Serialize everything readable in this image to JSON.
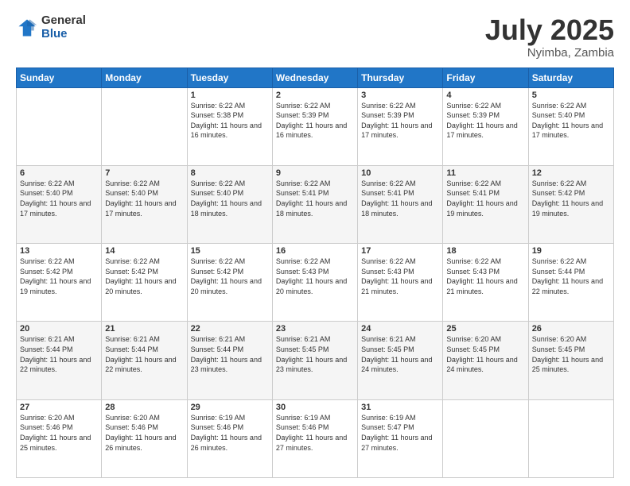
{
  "logo": {
    "general": "General",
    "blue": "Blue"
  },
  "title": {
    "month": "July 2025",
    "location": "Nyimba, Zambia"
  },
  "days_of_week": [
    "Sunday",
    "Monday",
    "Tuesday",
    "Wednesday",
    "Thursday",
    "Friday",
    "Saturday"
  ],
  "weeks": [
    [
      null,
      null,
      {
        "day": 1,
        "sunrise": "6:22 AM",
        "sunset": "5:38 PM",
        "daylight": "11 hours and 16 minutes."
      },
      {
        "day": 2,
        "sunrise": "6:22 AM",
        "sunset": "5:39 PM",
        "daylight": "11 hours and 16 minutes."
      },
      {
        "day": 3,
        "sunrise": "6:22 AM",
        "sunset": "5:39 PM",
        "daylight": "11 hours and 17 minutes."
      },
      {
        "day": 4,
        "sunrise": "6:22 AM",
        "sunset": "5:39 PM",
        "daylight": "11 hours and 17 minutes."
      },
      {
        "day": 5,
        "sunrise": "6:22 AM",
        "sunset": "5:40 PM",
        "daylight": "11 hours and 17 minutes."
      }
    ],
    [
      {
        "day": 6,
        "sunrise": "6:22 AM",
        "sunset": "5:40 PM",
        "daylight": "11 hours and 17 minutes."
      },
      {
        "day": 7,
        "sunrise": "6:22 AM",
        "sunset": "5:40 PM",
        "daylight": "11 hours and 17 minutes."
      },
      {
        "day": 8,
        "sunrise": "6:22 AM",
        "sunset": "5:40 PM",
        "daylight": "11 hours and 18 minutes."
      },
      {
        "day": 9,
        "sunrise": "6:22 AM",
        "sunset": "5:41 PM",
        "daylight": "11 hours and 18 minutes."
      },
      {
        "day": 10,
        "sunrise": "6:22 AM",
        "sunset": "5:41 PM",
        "daylight": "11 hours and 18 minutes."
      },
      {
        "day": 11,
        "sunrise": "6:22 AM",
        "sunset": "5:41 PM",
        "daylight": "11 hours and 19 minutes."
      },
      {
        "day": 12,
        "sunrise": "6:22 AM",
        "sunset": "5:42 PM",
        "daylight": "11 hours and 19 minutes."
      }
    ],
    [
      {
        "day": 13,
        "sunrise": "6:22 AM",
        "sunset": "5:42 PM",
        "daylight": "11 hours and 19 minutes."
      },
      {
        "day": 14,
        "sunrise": "6:22 AM",
        "sunset": "5:42 PM",
        "daylight": "11 hours and 20 minutes."
      },
      {
        "day": 15,
        "sunrise": "6:22 AM",
        "sunset": "5:42 PM",
        "daylight": "11 hours and 20 minutes."
      },
      {
        "day": 16,
        "sunrise": "6:22 AM",
        "sunset": "5:43 PM",
        "daylight": "11 hours and 20 minutes."
      },
      {
        "day": 17,
        "sunrise": "6:22 AM",
        "sunset": "5:43 PM",
        "daylight": "11 hours and 21 minutes."
      },
      {
        "day": 18,
        "sunrise": "6:22 AM",
        "sunset": "5:43 PM",
        "daylight": "11 hours and 21 minutes."
      },
      {
        "day": 19,
        "sunrise": "6:22 AM",
        "sunset": "5:44 PM",
        "daylight": "11 hours and 22 minutes."
      }
    ],
    [
      {
        "day": 20,
        "sunrise": "6:21 AM",
        "sunset": "5:44 PM",
        "daylight": "11 hours and 22 minutes."
      },
      {
        "day": 21,
        "sunrise": "6:21 AM",
        "sunset": "5:44 PM",
        "daylight": "11 hours and 22 minutes."
      },
      {
        "day": 22,
        "sunrise": "6:21 AM",
        "sunset": "5:44 PM",
        "daylight": "11 hours and 23 minutes."
      },
      {
        "day": 23,
        "sunrise": "6:21 AM",
        "sunset": "5:45 PM",
        "daylight": "11 hours and 23 minutes."
      },
      {
        "day": 24,
        "sunrise": "6:21 AM",
        "sunset": "5:45 PM",
        "daylight": "11 hours and 24 minutes."
      },
      {
        "day": 25,
        "sunrise": "6:20 AM",
        "sunset": "5:45 PM",
        "daylight": "11 hours and 24 minutes."
      },
      {
        "day": 26,
        "sunrise": "6:20 AM",
        "sunset": "5:45 PM",
        "daylight": "11 hours and 25 minutes."
      }
    ],
    [
      {
        "day": 27,
        "sunrise": "6:20 AM",
        "sunset": "5:46 PM",
        "daylight": "11 hours and 25 minutes."
      },
      {
        "day": 28,
        "sunrise": "6:20 AM",
        "sunset": "5:46 PM",
        "daylight": "11 hours and 26 minutes."
      },
      {
        "day": 29,
        "sunrise": "6:19 AM",
        "sunset": "5:46 PM",
        "daylight": "11 hours and 26 minutes."
      },
      {
        "day": 30,
        "sunrise": "6:19 AM",
        "sunset": "5:46 PM",
        "daylight": "11 hours and 27 minutes."
      },
      {
        "day": 31,
        "sunrise": "6:19 AM",
        "sunset": "5:47 PM",
        "daylight": "11 hours and 27 minutes."
      },
      null,
      null
    ]
  ],
  "labels": {
    "sunrise": "Sunrise:",
    "sunset": "Sunset:",
    "daylight": "Daylight:"
  }
}
